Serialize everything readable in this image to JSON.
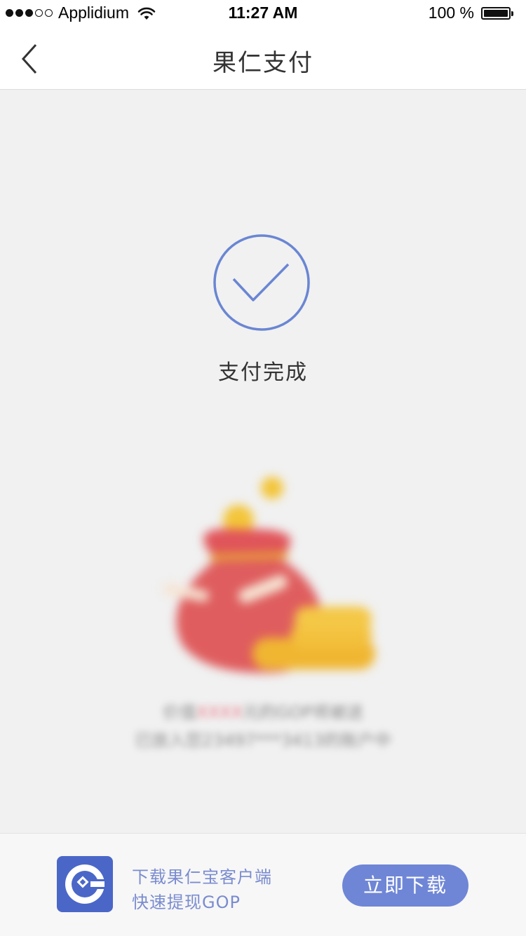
{
  "status_bar": {
    "signal_dots_filled": 3,
    "signal_dots_total": 5,
    "carrier": "Applidium",
    "time": "11:27 AM",
    "battery_text": "100 %",
    "battery_level": 1.0
  },
  "navbar": {
    "title": "果仁支付",
    "back_icon": "chevron-left-icon"
  },
  "result": {
    "icon": "check-circle-icon",
    "text": "支付完成",
    "accent_color": "#6a86d3"
  },
  "promo": {
    "illustration": "money-bag-with-coins",
    "line1_a": "价值",
    "line1_b": "XXXX",
    "line1_c": "元的GOP将被送",
    "line2": "已放入您23497***3413的账户中"
  },
  "banner": {
    "app_icon": "gop-logo-icon",
    "line1": "下载果仁宝客户端",
    "line2": "快速提现GOP",
    "button_label": "立即下载",
    "button_color": "#6f86d6"
  }
}
